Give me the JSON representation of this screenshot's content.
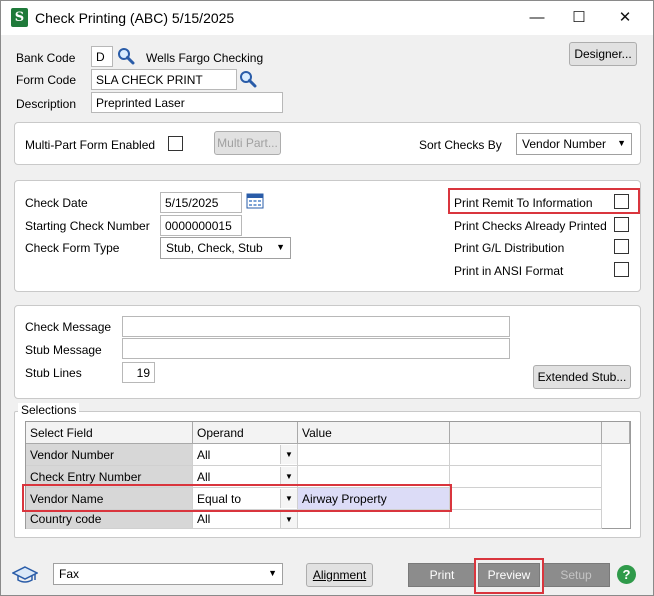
{
  "window": {
    "title": "Check Printing (ABC) 5/15/2025",
    "minimize": "—",
    "maximize": "☐",
    "close": "✕",
    "app_icon": "S"
  },
  "header": {
    "bank_code_label": "Bank Code",
    "bank_code_value": "D",
    "bank_name": "Wells Fargo Checking",
    "form_code_label": "Form Code",
    "form_code_value": "SLA CHECK PRINT",
    "description_label": "Description",
    "description_value": "Preprinted Laser",
    "designer_button": "Designer..."
  },
  "multipart": {
    "label": "Multi-Part Form Enabled",
    "checked": false,
    "button": "Multi Part...",
    "sort_label": "Sort Checks By",
    "sort_value": "Vendor Number"
  },
  "check": {
    "date_label": "Check Date",
    "date_value": "5/15/2025",
    "start_label": "Starting Check Number",
    "start_value": "0000000015",
    "form_type_label": "Check Form Type",
    "form_type_value": "Stub, Check, Stub",
    "options": [
      {
        "label": "Print Remit To Information",
        "checked": false
      },
      {
        "label": "Print Checks Already Printed",
        "checked": false
      },
      {
        "label": "Print G/L Distribution",
        "checked": false
      },
      {
        "label": "Print in ANSI Format",
        "checked": false
      }
    ]
  },
  "messages": {
    "check_message_label": "Check Message",
    "check_message_value": "",
    "stub_message_label": "Stub Message",
    "stub_message_value": "",
    "stub_lines_label": "Stub Lines",
    "stub_lines_value": "19",
    "extended_stub_button": "Extended Stub..."
  },
  "selections": {
    "group_label": "Selections",
    "columns": [
      "Select Field",
      "Operand",
      "Value"
    ],
    "rows": [
      {
        "field": "Vendor Number",
        "operand": "All",
        "value": ""
      },
      {
        "field": "Check Entry Number",
        "operand": "All",
        "value": ""
      },
      {
        "field": "Vendor Name",
        "operand": "Equal to",
        "value": "Airway Property"
      },
      {
        "field": "Country code",
        "operand": "All",
        "value": ""
      }
    ]
  },
  "footer": {
    "output_value": "Fax",
    "alignment_button": "Alignment",
    "print_button": "Print",
    "preview_button": "Preview",
    "setup_button": "Setup",
    "help_icon": "?"
  },
  "colors": {
    "highlight": "#d9353d",
    "vendor_name_value_bg": "#dcdcf7",
    "help_green": "#2f9a4a"
  }
}
